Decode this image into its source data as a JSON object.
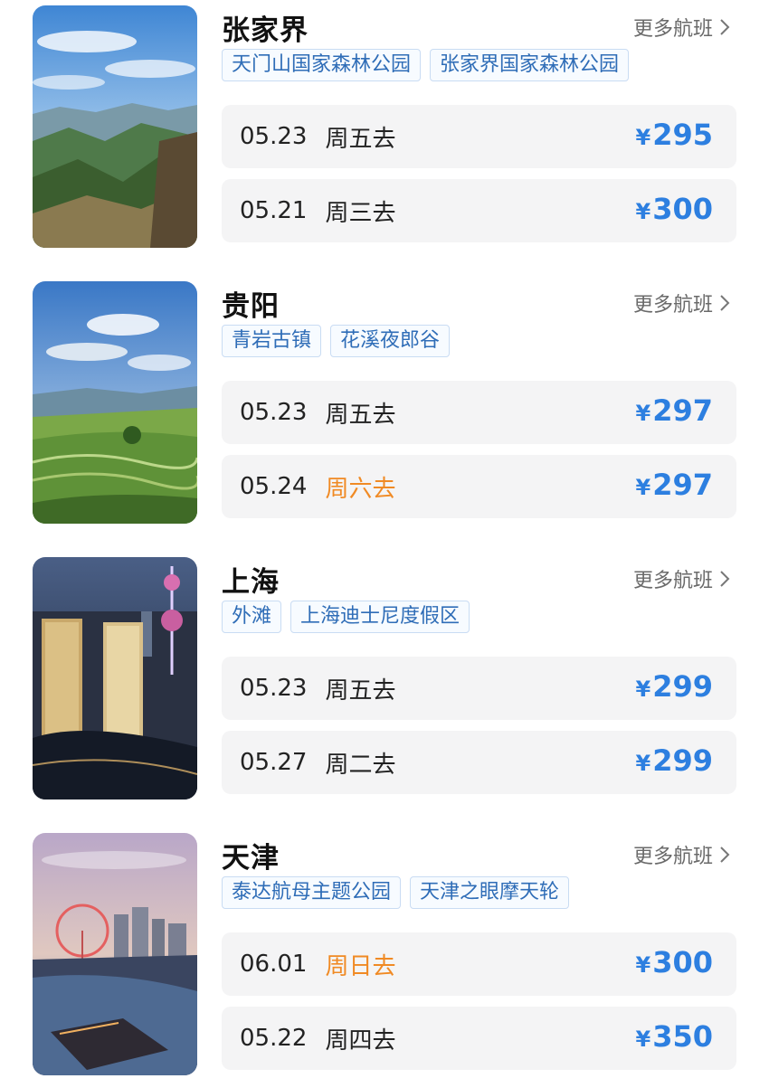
{
  "more_label": "更多航班",
  "cards": [
    {
      "city": "张家界",
      "image": "mountain-landscape",
      "tags": [
        "天门山国家森林公园",
        "张家界国家森林公园"
      ],
      "flights": [
        {
          "date": "05.23",
          "dow": "周五去",
          "weekend": false,
          "currency": "¥",
          "price": "295"
        },
        {
          "date": "05.21",
          "dow": "周三去",
          "weekend": false,
          "currency": "¥",
          "price": "300"
        }
      ]
    },
    {
      "city": "贵阳",
      "image": "terraced-fields",
      "tags": [
        "青岩古镇",
        "花溪夜郎谷"
      ],
      "flights": [
        {
          "date": "05.23",
          "dow": "周五去",
          "weekend": false,
          "currency": "¥",
          "price": "297"
        },
        {
          "date": "05.24",
          "dow": "周六去",
          "weekend": true,
          "currency": "¥",
          "price": "297"
        }
      ]
    },
    {
      "city": "上海",
      "image": "city-skyline-night",
      "tags": [
        "外滩",
        "上海迪士尼度假区"
      ],
      "flights": [
        {
          "date": "05.23",
          "dow": "周五去",
          "weekend": false,
          "currency": "¥",
          "price": "299"
        },
        {
          "date": "05.27",
          "dow": "周二去",
          "weekend": false,
          "currency": "¥",
          "price": "299"
        }
      ]
    },
    {
      "city": "天津",
      "image": "ferris-wheel-river",
      "tags": [
        "泰达航母主题公园",
        "天津之眼摩天轮"
      ],
      "flights": [
        {
          "date": "06.01",
          "dow": "周日去",
          "weekend": true,
          "currency": "¥",
          "price": "300"
        },
        {
          "date": "05.22",
          "dow": "周四去",
          "weekend": false,
          "currency": "¥",
          "price": "350"
        }
      ]
    }
  ],
  "colors": {
    "price": "#2d7fe0",
    "weekend": "#f08a24",
    "tag_text": "#2f6db7",
    "tag_border": "#c9dcf3",
    "row_bg": "#f4f4f5"
  }
}
